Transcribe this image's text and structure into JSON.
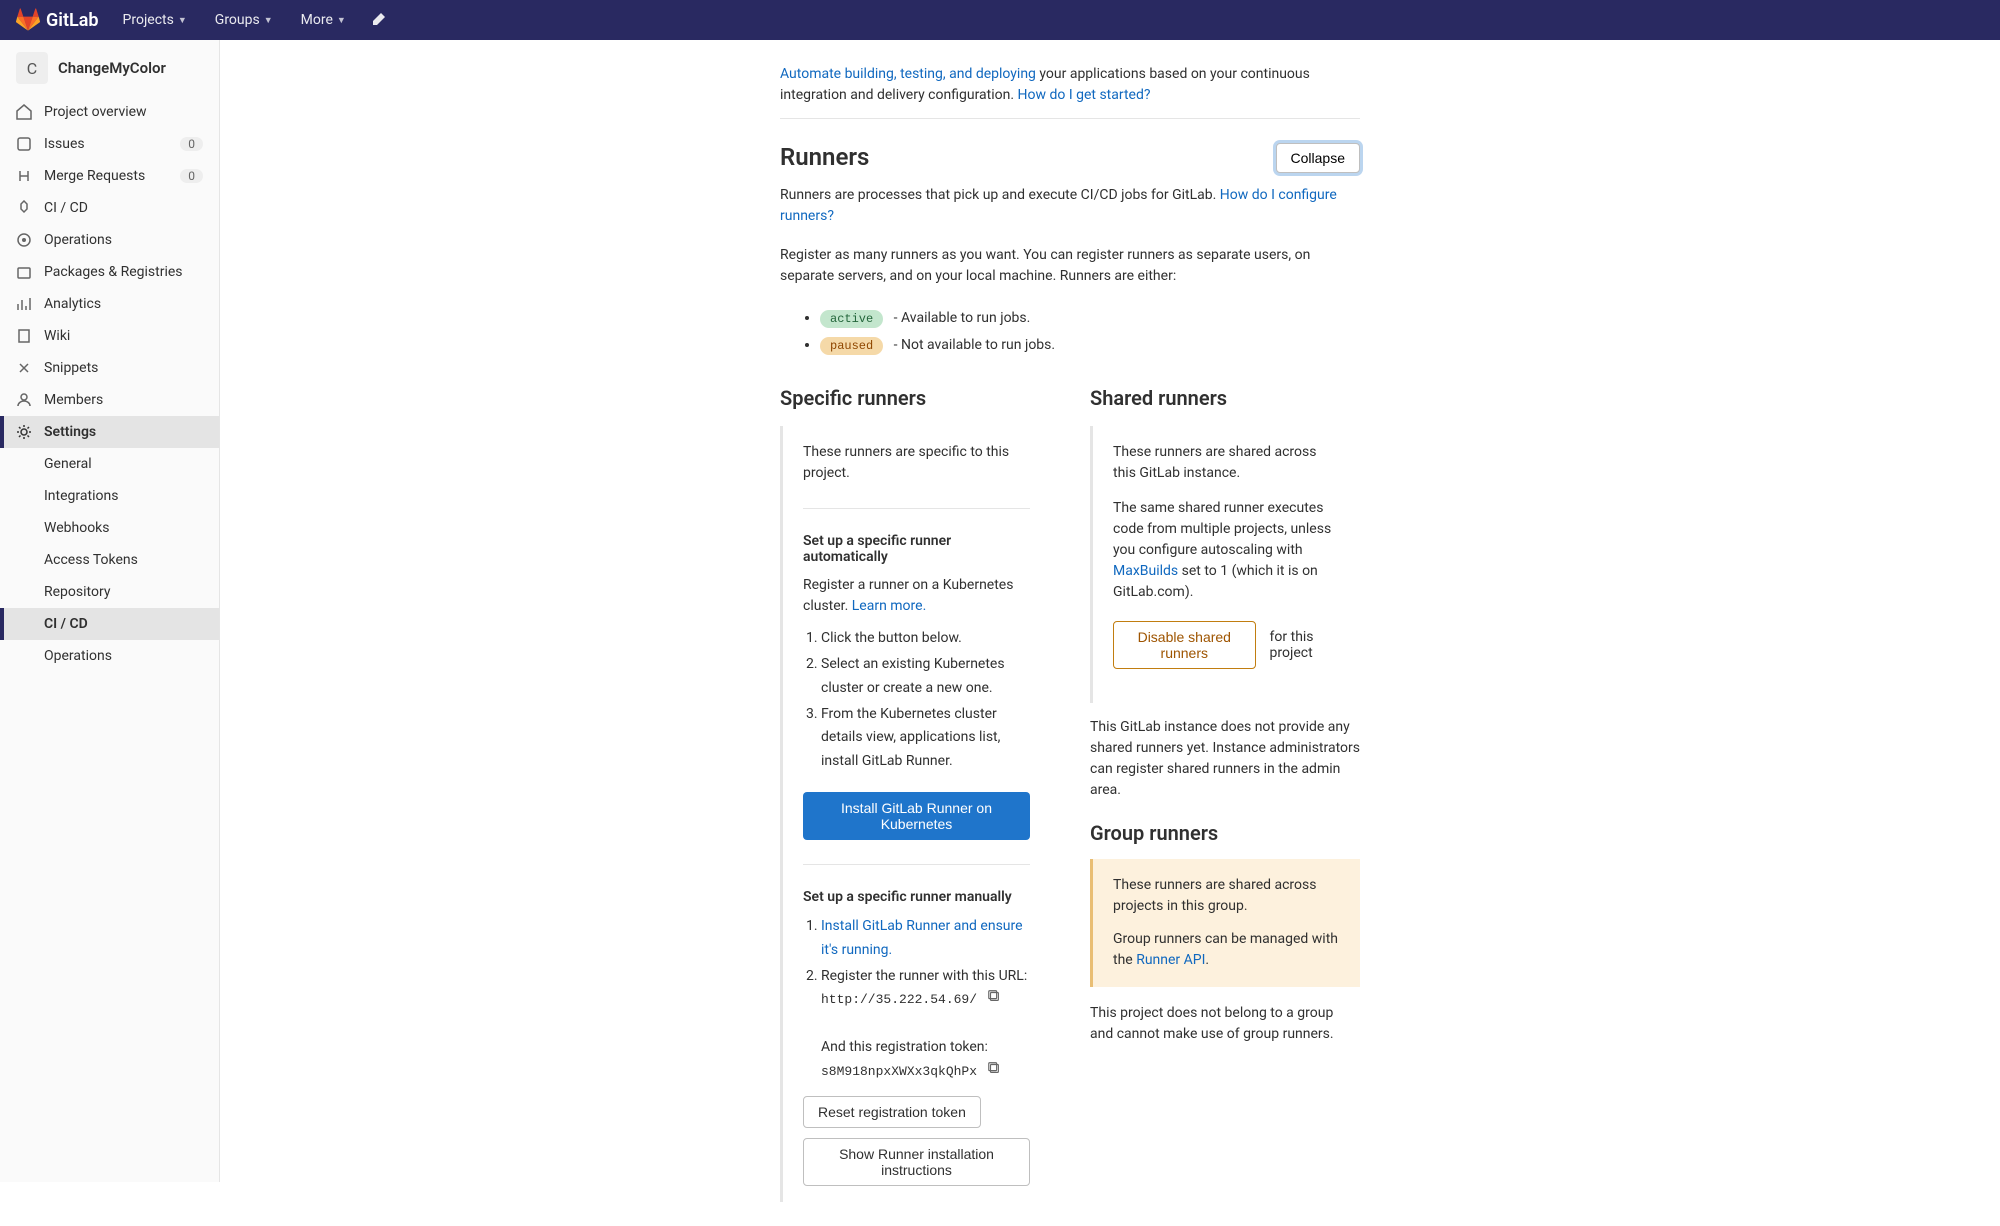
{
  "topbar": {
    "brand": "GitLab",
    "projects": "Projects",
    "groups": "Groups",
    "more": "More"
  },
  "sidebar": {
    "project_letter": "C",
    "project_name": "ChangeMyColor",
    "items": [
      {
        "label": "Project overview"
      },
      {
        "label": "Issues",
        "badge": "0"
      },
      {
        "label": "Merge Requests",
        "badge": "0"
      },
      {
        "label": "CI / CD"
      },
      {
        "label": "Operations"
      },
      {
        "label": "Packages & Registries"
      },
      {
        "label": "Analytics"
      },
      {
        "label": "Wiki"
      },
      {
        "label": "Snippets"
      },
      {
        "label": "Members"
      },
      {
        "label": "Settings"
      }
    ],
    "subitems": [
      {
        "label": "General"
      },
      {
        "label": "Integrations"
      },
      {
        "label": "Webhooks"
      },
      {
        "label": "Access Tokens"
      },
      {
        "label": "Repository"
      },
      {
        "label": "CI / CD"
      },
      {
        "label": "Operations"
      }
    ]
  },
  "intro": {
    "link": "Automate building, testing, and deploying",
    "text": " your applications based on your continuous integration and delivery configuration. ",
    "link2": "How do I get started?"
  },
  "runners": {
    "title": "Runners",
    "collapse": "Collapse",
    "desc_text": "Runners are processes that pick up and execute CI/CD jobs for GitLab. ",
    "desc_link": "How do I configure runners?",
    "register_text": "Register as many runners as you want. You can register runners as separate users, on separate servers, and on your local machine. Runners are either:",
    "active_label": "active",
    "active_desc": " - Available to run jobs.",
    "paused_label": "paused",
    "paused_desc": " - Not available to run jobs."
  },
  "specific": {
    "title": "Specific runners",
    "intro": "These runners are specific to this project.",
    "auto_title": "Set up a specific runner automatically",
    "auto_text": "Register a runner on a Kubernetes cluster. ",
    "auto_link": "Learn more.",
    "steps": [
      "Click the button below.",
      "Select an existing Kubernetes cluster or create a new one.",
      "From the Kubernetes cluster details view, applications list, install GitLab Runner."
    ],
    "install_btn": "Install GitLab Runner on Kubernetes",
    "manual_title": "Set up a specific runner manually",
    "manual_step1": "Install GitLab Runner and ensure it's running.",
    "manual_step2": "Register the runner with this URL:",
    "url": "http://35.222.54.69/",
    "token_label": "And this registration token:",
    "token": "s8M918npxXWXx3qkQhPx",
    "reset_btn": "Reset registration token",
    "show_btn": "Show Runner installation instructions"
  },
  "shared": {
    "title": "Shared runners",
    "intro": "These runners are shared across this GitLab instance.",
    "desc1": "The same shared runner executes code from multiple projects, unless you configure autoscaling with ",
    "desc_link": "MaxBuilds",
    "desc2": " set to 1 (which it is on GitLab.com).",
    "disable_btn": "Disable shared runners",
    "disable_suffix": "for this project",
    "note": "This GitLab instance does not provide any shared runners yet. Instance administrators can register shared runners in the admin area."
  },
  "group": {
    "title": "Group runners",
    "box_text1": "These runners are shared across projects in this group.",
    "box_text2": "Group runners can be managed with the ",
    "box_link": "Runner API",
    "box_text3": ".",
    "note": "This project does not belong to a group and cannot make use of group runners."
  }
}
